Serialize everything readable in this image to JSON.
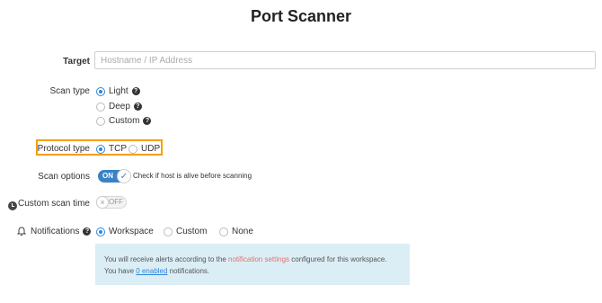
{
  "page": {
    "title": "Port Scanner"
  },
  "target": {
    "label": "Target",
    "placeholder": "Hostname / IP Address",
    "value": ""
  },
  "scan_type": {
    "label": "Scan type",
    "options": [
      {
        "label": "Light",
        "selected": true,
        "help": true
      },
      {
        "label": "Deep",
        "selected": false,
        "help": true
      },
      {
        "label": "Custom",
        "selected": false,
        "help": true
      }
    ]
  },
  "protocol_type": {
    "label": "Protocol type",
    "options": [
      {
        "label": "TCP",
        "selected": true
      },
      {
        "label": "UDP",
        "selected": false
      }
    ]
  },
  "scan_options": {
    "label": "Scan options",
    "toggle_state": "ON",
    "check_label": "Check if host is alive before scanning"
  },
  "custom_scan_time": {
    "label": "Custom scan time",
    "toggle_state": "OFF",
    "icon": "clock-icon"
  },
  "notifications": {
    "label": "Notifications",
    "icon": "bell-icon",
    "options": [
      {
        "label": "Workspace",
        "selected": true
      },
      {
        "label": "Custom",
        "selected": false
      },
      {
        "label": "None",
        "selected": false
      }
    ],
    "info": {
      "line1_prefix": "You will receive alerts according to the ",
      "line1_link": "notification settings",
      "line1_suffix": " configured for this workspace.",
      "line2_prefix": "You have ",
      "line2_link": "0 enabled",
      "line2_suffix": " notifications."
    }
  },
  "colors": {
    "accent": "#2f86d8",
    "highlight": "#f5a000",
    "toggle_on": "#3a82c4",
    "info_bg": "#dbeef6",
    "link_red": "#e8706a"
  }
}
